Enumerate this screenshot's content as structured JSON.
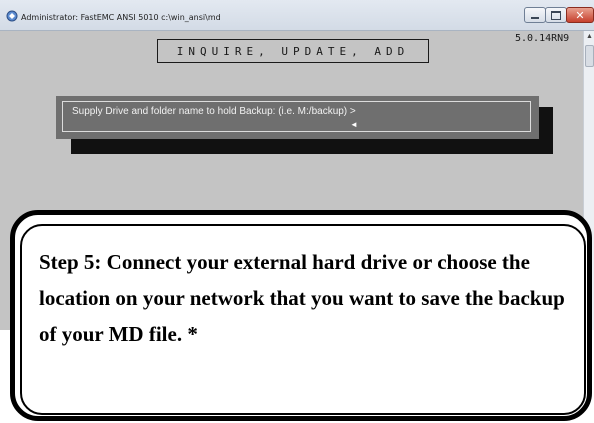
{
  "window": {
    "title": "Administrator:  FastEMC ANSI 5010 c:\\win_ansi\\md",
    "controls": {
      "minimize": "minimize",
      "maximize": "maximize",
      "close": "✕"
    }
  },
  "console": {
    "header": "INQUIRE, UPDATE, ADD",
    "version": "5.0.14RN9",
    "prompt": "Supply Drive and folder name to hold Backup: (i.e. M:/backup) >",
    "cursor": "◄"
  },
  "callout": {
    "text": "Step 5: Connect your external hard drive or choose the location on your network that you want to save the backup of your MD file. *"
  },
  "colors": {
    "console_bg": "#c4c4c4",
    "prompt_panel": "#6f6f6f",
    "prompt_shadow": "#111111",
    "close_button": "#c6402d"
  }
}
